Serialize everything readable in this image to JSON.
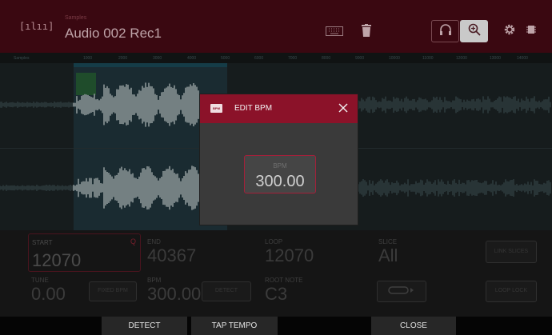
{
  "header": {
    "program_label": "Samples",
    "title": "Audio 002 Rec1"
  },
  "ruler": {
    "track_label": "Samples",
    "ticks": [
      "1000",
      "2000",
      "3000",
      "4000",
      "5000",
      "6000",
      "7000",
      "8000",
      "9000",
      "10000",
      "11000",
      "12000",
      "13000",
      "14000",
      "15000"
    ]
  },
  "controls": {
    "start": {
      "label": "START",
      "value": "12070",
      "badge": "Q"
    },
    "end": {
      "label": "END",
      "value": "40367"
    },
    "loop": {
      "label": "LOOP",
      "value": "12070"
    },
    "slice": {
      "label": "SLICE",
      "value": "All"
    },
    "tune": {
      "label": "TUNE",
      "value": "0.00"
    },
    "bpm": {
      "label": "BPM",
      "value": "300.00"
    },
    "root_note": {
      "label": "ROOT NOTE",
      "value": "C3"
    },
    "fixed_bpm_label": "FIXED BPM",
    "detect_small_label": "DETECT",
    "link_slices_label": "LINK SLICES",
    "loop_lock_label": "LOOP LOCK"
  },
  "dialog": {
    "badge": "BPM",
    "title": "EDIT BPM",
    "field_label": "BPM",
    "field_value": "300.00"
  },
  "footer": {
    "detect_label": "DETECT",
    "tap_tempo_label": "TAP TEMPO",
    "close_label": "CLOSE"
  },
  "colors": {
    "header_red": "#3a0811",
    "dialog_red": "#8b1229",
    "field_border": "#a3203a"
  },
  "icons": [
    "waveform-icon",
    "keyboard-icon",
    "trash-icon",
    "headphones-icon",
    "zoom-icon",
    "gear-icon",
    "settings-icon",
    "close-icon",
    "loop-icon"
  ]
}
